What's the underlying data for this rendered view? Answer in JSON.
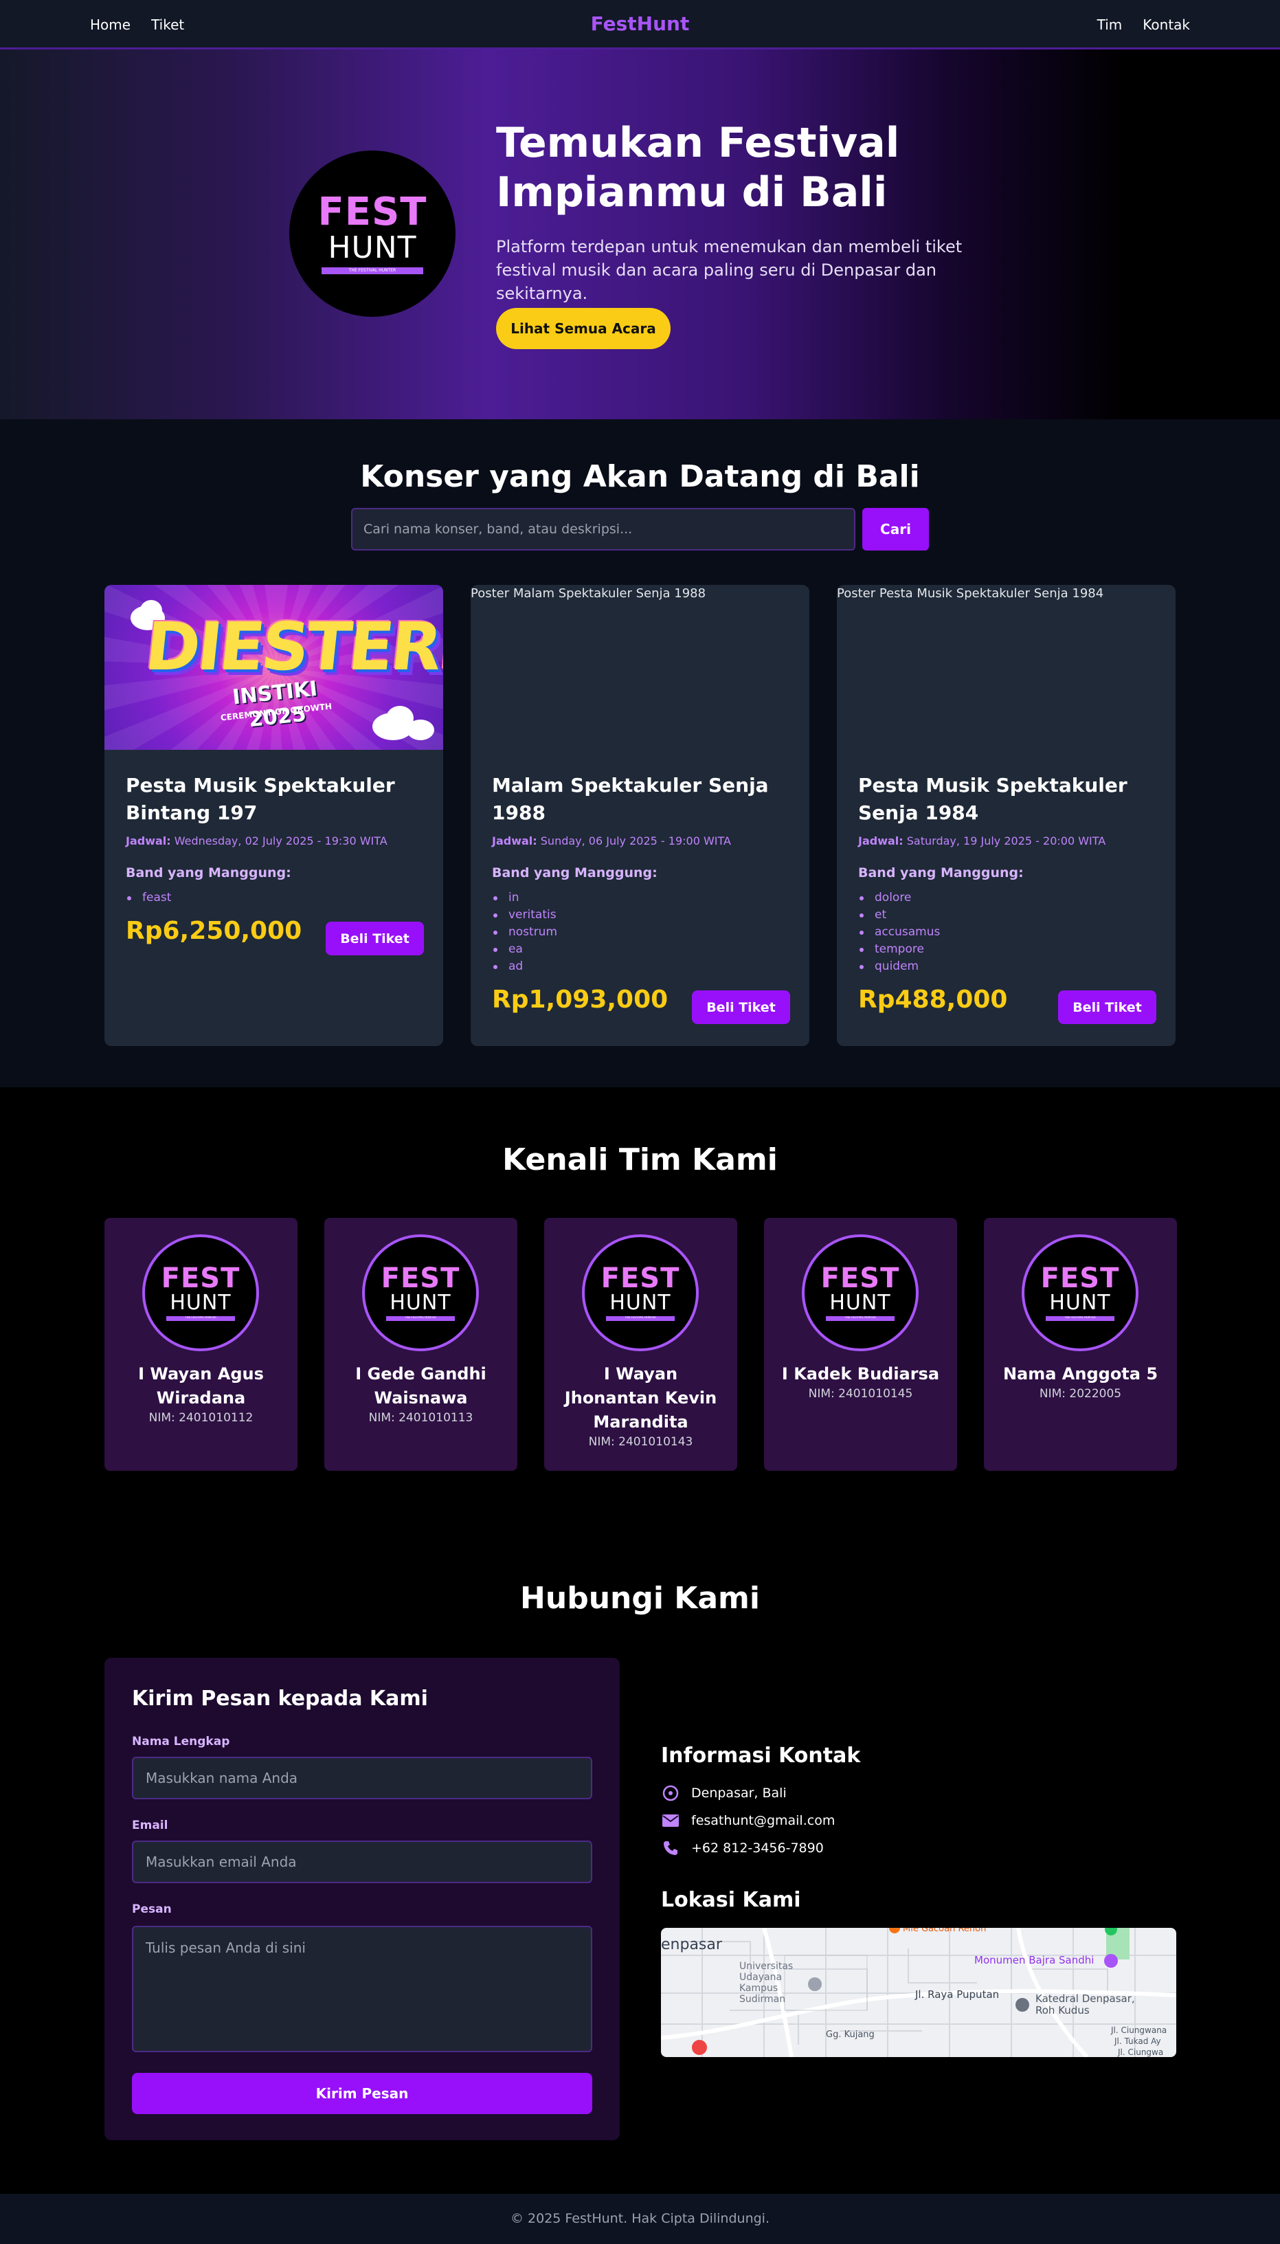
{
  "nav": {
    "left": [
      "Home",
      "Tiket"
    ],
    "brand": "FestHunt",
    "right": [
      "Tim",
      "Kontak"
    ]
  },
  "logo": {
    "line1": "FEST",
    "line2": "HUNT",
    "tagline": "THE FESTIVAL HUNTER"
  },
  "hero": {
    "title": "Temukan Festival Impianmu di Bali",
    "description": "Platform terdepan untuk menemukan dan membeli tiket festival musik dan acara paling seru di Denpasar dan sekitarnya.",
    "cta": "Lihat Semua Acara"
  },
  "events": {
    "title": "Konser yang Akan Datang di Bali",
    "search_placeholder": "Cari nama konser, band, atau deskripsi...",
    "search_button": "Cari",
    "schedule_label": "Jadwal:",
    "bands_label": "Band yang Manggung:",
    "buy_label": "Beli Tiket",
    "poster1": {
      "word": "DIESTERIA",
      "sub1": "INSTIKI 2025",
      "sub2": "CEREMONY OF GROWTH"
    },
    "items": [
      {
        "image_alt": "",
        "title": "Pesta Musik Spektakuler Bintang 197",
        "date": "Wednesday, 02 July 2025 - 19:30 WITA",
        "bands": [
          "feast"
        ],
        "price": "Rp6,250,000"
      },
      {
        "image_alt": "Poster Malam Spektakuler Senja 1988",
        "title": "Malam Spektakuler Senja 1988",
        "date": "Sunday, 06 July 2025 - 19:00 WITA",
        "bands": [
          "in",
          "veritatis",
          "nostrum",
          "ea",
          "ad"
        ],
        "price": "Rp1,093,000"
      },
      {
        "image_alt": "Poster Pesta Musik Spektakuler Senja 1984",
        "title": "Pesta Musik Spektakuler Senja 1984",
        "date": "Saturday, 19 July 2025 - 20:00 WITA",
        "bands": [
          "dolore",
          "et",
          "accusamus",
          "tempore",
          "quidem"
        ],
        "price": "Rp488,000"
      }
    ]
  },
  "team": {
    "title": "Kenali Tim Kami",
    "members": [
      {
        "name": "I Wayan Agus Wiradana",
        "nim": "NIM: 2401010112"
      },
      {
        "name": "I Gede Gandhi Waisnawa",
        "nim": "NIM: 2401010113"
      },
      {
        "name": "I Wayan Jhonantan Kevin Marandita",
        "nim": "NIM: 2401010143"
      },
      {
        "name": "I Kadek Budiarsa",
        "nim": "NIM: 2401010145"
      },
      {
        "name": "Nama Anggota 5",
        "nim": "NIM: 2022005"
      }
    ]
  },
  "contact": {
    "title": "Hubungi Kami",
    "form_title": "Kirim Pesan kepada Kami",
    "name_label": "Nama Lengkap",
    "name_placeholder": "Masukkan nama Anda",
    "email_label": "Email",
    "email_placeholder": "Masukkan email Anda",
    "message_label": "Pesan",
    "message_placeholder": "Tulis pesan Anda di sini",
    "submit": "Kirim Pesan",
    "info_title": "Informasi Kontak",
    "location": "Denpasar, Bali",
    "email": "fesathunt@gmail.com",
    "phone": "+62 812-3456-7890",
    "map_title": "Lokasi Kami",
    "map_labels": {
      "city": "enpasar",
      "university": "Universitas Udayana Kampus Sudirman",
      "temple": "Monumen Bajra Sandhi",
      "road1": "Jl. Raya Puputan",
      "church": "Katedral Denpasar, Roh Kudus",
      "road2": "Gg. Kujang",
      "road3": "Jl. Ciungwana",
      "road4": "Jl. Tukad Ay",
      "road5": "Jl. Ciungwa",
      "hotel": "Mie Gacoan Renon"
    }
  },
  "footer": {
    "text": "© 2025 FestHunt. Hak Cipta Dilindungi."
  },
  "colors": {
    "accent": "#9810fa",
    "brand": "#a855f7",
    "price": "#facc15",
    "cta": "#facc15"
  }
}
